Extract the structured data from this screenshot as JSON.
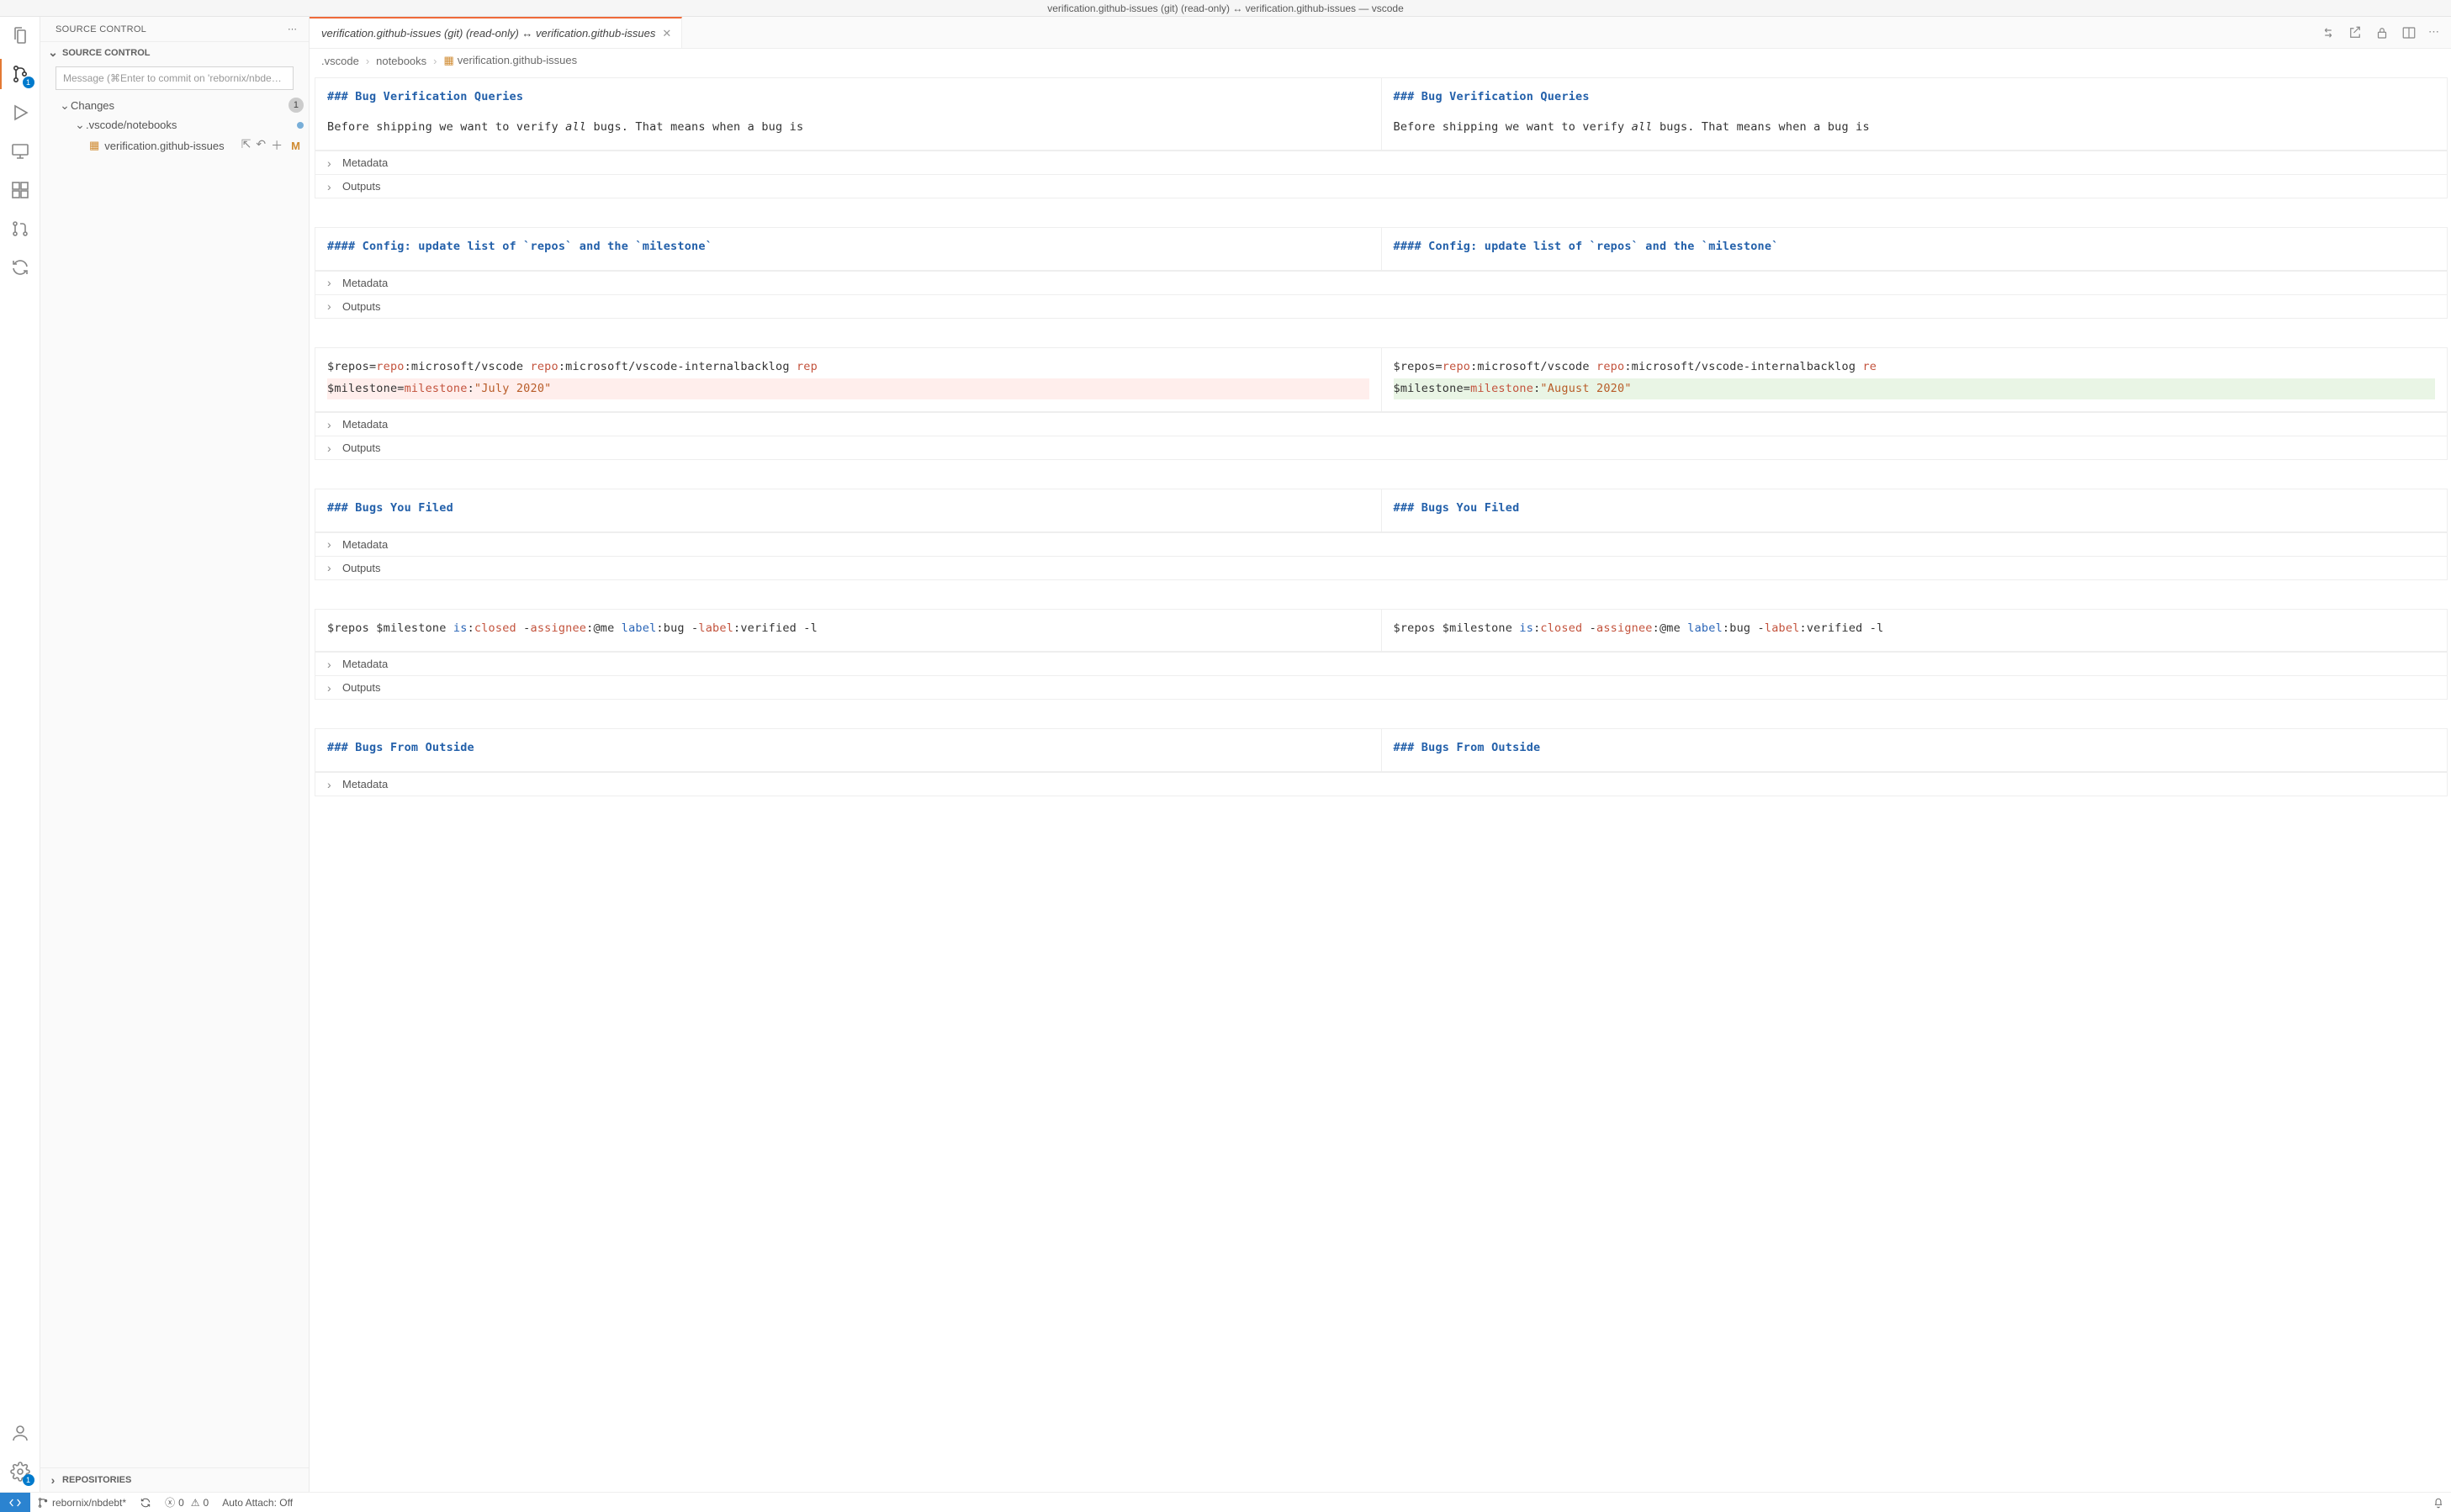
{
  "titlebar": "verification.github-issues (git) (read-only) ↔ verification.github-issues — vscode",
  "sidebar": {
    "title": "SOURCE CONTROL",
    "section_header": "SOURCE CONTROL",
    "commit_placeholder": "Message (⌘Enter to commit on 'rebornix/nbde…",
    "changes_label": "Changes",
    "changes_count": "1",
    "folder_label": ".vscode/notebooks",
    "file_label": "verification.github-issues",
    "file_status": "M",
    "repositories_label": "REPOSITORIES",
    "scm_badge": "1",
    "settings_badge": "1"
  },
  "tab": {
    "label": "verification.github-issues (git) (read-only) ↔ verification.github-issues"
  },
  "breadcrumbs": {
    "a": ".vscode",
    "b": "notebooks",
    "c": "verification.github-issues"
  },
  "fold_labels": {
    "metadata": "Metadata",
    "outputs": "Outputs"
  },
  "chart_data": [
    {
      "type": "markdown",
      "left": {
        "header": "### Bug Verification Queries",
        "body": "Before shipping we want to verify _all_ bugs. That means when a bug is"
      },
      "right": {
        "header": "### Bug Verification Queries",
        "body": "Before shipping we want to verify _all_ bugs. That means when a bug is"
      },
      "folds": [
        "metadata",
        "outputs"
      ]
    },
    {
      "type": "markdown",
      "left": {
        "header": "#### Config: update list of `repos` and the `milestone`"
      },
      "right": {
        "header": "#### Config: update list of `repos` and the `milestone`"
      },
      "folds": [
        "metadata",
        "outputs"
      ]
    },
    {
      "type": "code",
      "left": {
        "line1_pre": "$repos=",
        "line1_repo": "repo",
        "line1_post1": ":microsoft/vscode ",
        "line1_repo2": "repo",
        "line1_post2": ":microsoft/vscode-internalbacklog ",
        "line1_truncated": "rep",
        "line2_pre": "$milestone=",
        "line2_key": "milestone",
        "line2_colon": ":",
        "line2_val": "\"July 2020\"",
        "line2_changed": true
      },
      "right": {
        "line1_pre": "$repos=",
        "line1_repo": "repo",
        "line1_post1": ":microsoft/vscode ",
        "line1_repo2": "repo",
        "line1_post2": ":microsoft/vscode-internalbacklog ",
        "line1_truncated": "re",
        "line2_pre": "$milestone=",
        "line2_key": "milestone",
        "line2_colon": ":",
        "line2_val": "\"August 2020\"",
        "line2_changed": true
      },
      "folds": [
        "metadata",
        "outputs"
      ]
    },
    {
      "type": "markdown",
      "left": {
        "header": "### Bugs You Filed"
      },
      "right": {
        "header": "### Bugs You Filed"
      },
      "folds": [
        "metadata",
        "outputs"
      ]
    },
    {
      "type": "code-single",
      "left": {
        "segs": [
          {
            "t": "$repos $milestone ",
            "c": "txt"
          },
          {
            "t": "is",
            "c": "sblue"
          },
          {
            "t": ":",
            "c": "txt"
          },
          {
            "t": "closed",
            "c": "sred"
          },
          {
            "t": " -",
            "c": "txt"
          },
          {
            "t": "assignee",
            "c": "sred"
          },
          {
            "t": ":@me ",
            "c": "txt"
          },
          {
            "t": "label",
            "c": "sblue"
          },
          {
            "t": ":bug -",
            "c": "txt"
          },
          {
            "t": "label",
            "c": "sred"
          },
          {
            "t": ":verified -l",
            "c": "txt"
          }
        ]
      },
      "right": {
        "segs": [
          {
            "t": "$repos $milestone ",
            "c": "txt"
          },
          {
            "t": "is",
            "c": "sblue"
          },
          {
            "t": ":",
            "c": "txt"
          },
          {
            "t": "closed",
            "c": "sred"
          },
          {
            "t": " -",
            "c": "txt"
          },
          {
            "t": "assignee",
            "c": "sred"
          },
          {
            "t": ":@me ",
            "c": "txt"
          },
          {
            "t": "label",
            "c": "sblue"
          },
          {
            "t": ":bug -",
            "c": "txt"
          },
          {
            "t": "label",
            "c": "sred"
          },
          {
            "t": ":verified -l",
            "c": "txt"
          }
        ]
      },
      "folds": [
        "metadata",
        "outputs"
      ]
    },
    {
      "type": "markdown",
      "left": {
        "header": "### Bugs From Outside"
      },
      "right": {
        "header": "### Bugs From Outside"
      },
      "folds": [
        "metadata"
      ]
    }
  ],
  "statusbar": {
    "branch": "rebornix/nbdebt*",
    "errors": "0",
    "warnings": "0",
    "autoattach": "Auto Attach: Off"
  }
}
